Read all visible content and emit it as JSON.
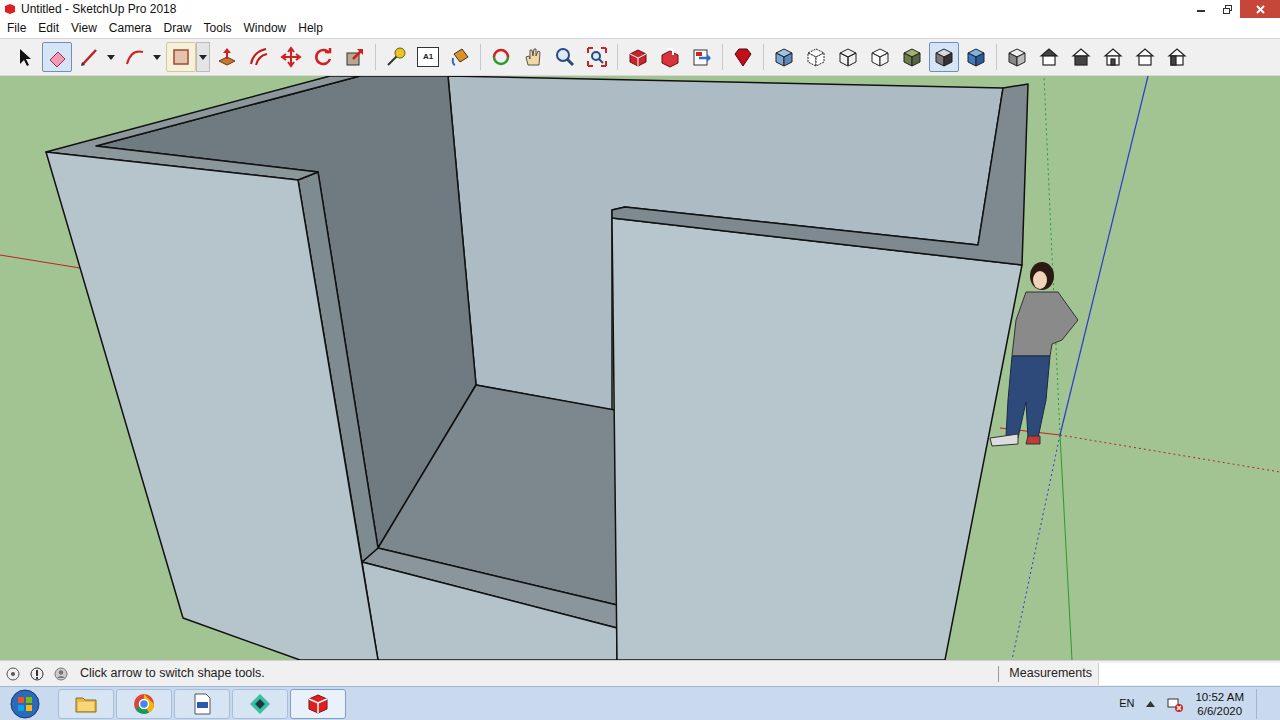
{
  "window": {
    "title": "Untitled - SketchUp Pro 2018"
  },
  "menu": [
    "File",
    "Edit",
    "View",
    "Camera",
    "Draw",
    "Tools",
    "Window",
    "Help"
  ],
  "toolbar": {
    "groups": [
      [
        {
          "kind": "select",
          "selected": false,
          "hovered": false,
          "has_menu": false
        },
        {
          "kind": "eraser",
          "selected": true,
          "hovered": false,
          "has_menu": false
        },
        {
          "kind": "pencil",
          "selected": false,
          "hovered": false,
          "has_menu": true
        },
        {
          "kind": "arc",
          "selected": false,
          "hovered": false,
          "has_menu": true
        },
        {
          "kind": "rectangle",
          "selected": false,
          "hovered": true,
          "has_menu": true
        },
        {
          "kind": "pushpull",
          "selected": false,
          "hovered": false,
          "has_menu": false
        },
        {
          "kind": "offset",
          "selected": false,
          "hovered": false,
          "has_menu": false
        },
        {
          "kind": "move",
          "selected": false,
          "hovered": false,
          "has_menu": false
        },
        {
          "kind": "rotate",
          "selected": false,
          "hovered": false,
          "has_menu": false
        },
        {
          "kind": "scale",
          "selected": false,
          "hovered": false,
          "has_menu": false
        }
      ],
      [
        {
          "kind": "tape",
          "selected": false,
          "hovered": false,
          "has_menu": false
        },
        {
          "kind": "text",
          "selected": false,
          "hovered": false,
          "has_menu": false,
          "label": "A1"
        },
        {
          "kind": "paint",
          "selected": false,
          "hovered": false,
          "has_menu": false
        }
      ],
      [
        {
          "kind": "orbit",
          "selected": false,
          "hovered": false,
          "has_menu": false
        },
        {
          "kind": "pan",
          "selected": false,
          "hovered": false,
          "has_menu": false
        },
        {
          "kind": "zoom",
          "selected": false,
          "hovered": false,
          "has_menu": false
        },
        {
          "kind": "zoom-extents",
          "selected": false,
          "hovered": false,
          "has_menu": false
        }
      ],
      [
        {
          "kind": "warehouse",
          "selected": false,
          "hovered": false,
          "has_menu": false
        },
        {
          "kind": "share",
          "selected": false,
          "hovered": false,
          "has_menu": false
        },
        {
          "kind": "layout",
          "selected": false,
          "hovered": false,
          "has_menu": false
        }
      ],
      [
        {
          "kind": "ruby",
          "selected": false,
          "hovered": false,
          "has_menu": false
        }
      ],
      [
        {
          "kind": "xray",
          "selected": false,
          "hovered": false,
          "has_menu": false
        },
        {
          "kind": "back-edges",
          "selected": false,
          "hovered": false,
          "has_menu": false
        },
        {
          "kind": "wireframe",
          "selected": false,
          "hovered": false,
          "has_menu": false
        },
        {
          "kind": "hidden-line",
          "selected": false,
          "hovered": false,
          "has_menu": false
        },
        {
          "kind": "shaded",
          "selected": false,
          "hovered": false,
          "has_menu": false
        },
        {
          "kind": "shaded-textures",
          "selected": true,
          "hovered": false,
          "has_menu": false
        },
        {
          "kind": "monochrome",
          "selected": false,
          "hovered": false,
          "has_menu": false
        }
      ],
      [
        {
          "kind": "iso",
          "selected": false,
          "hovered": false,
          "has_menu": false
        },
        {
          "kind": "top",
          "selected": false,
          "hovered": false,
          "has_menu": false
        },
        {
          "kind": "front",
          "selected": false,
          "hovered": false,
          "has_menu": false
        },
        {
          "kind": "right",
          "selected": false,
          "hovered": false,
          "has_menu": false
        },
        {
          "kind": "back",
          "selected": false,
          "hovered": false,
          "has_menu": false
        },
        {
          "kind": "left",
          "selected": false,
          "hovered": false,
          "has_menu": false
        }
      ]
    ]
  },
  "status_bar": {
    "hint": "Click arrow to switch shape tools.",
    "measurements_label": "Measurements"
  },
  "taskbar": {
    "apps": [
      {
        "kind": "explorer",
        "active": false
      },
      {
        "kind": "chrome",
        "active": false
      },
      {
        "kind": "document",
        "active": false
      },
      {
        "kind": "filmora",
        "active": false
      },
      {
        "kind": "sketchup",
        "active": true
      }
    ],
    "language": "EN",
    "time": "10:52 AM",
    "date": "6/6/2020"
  }
}
